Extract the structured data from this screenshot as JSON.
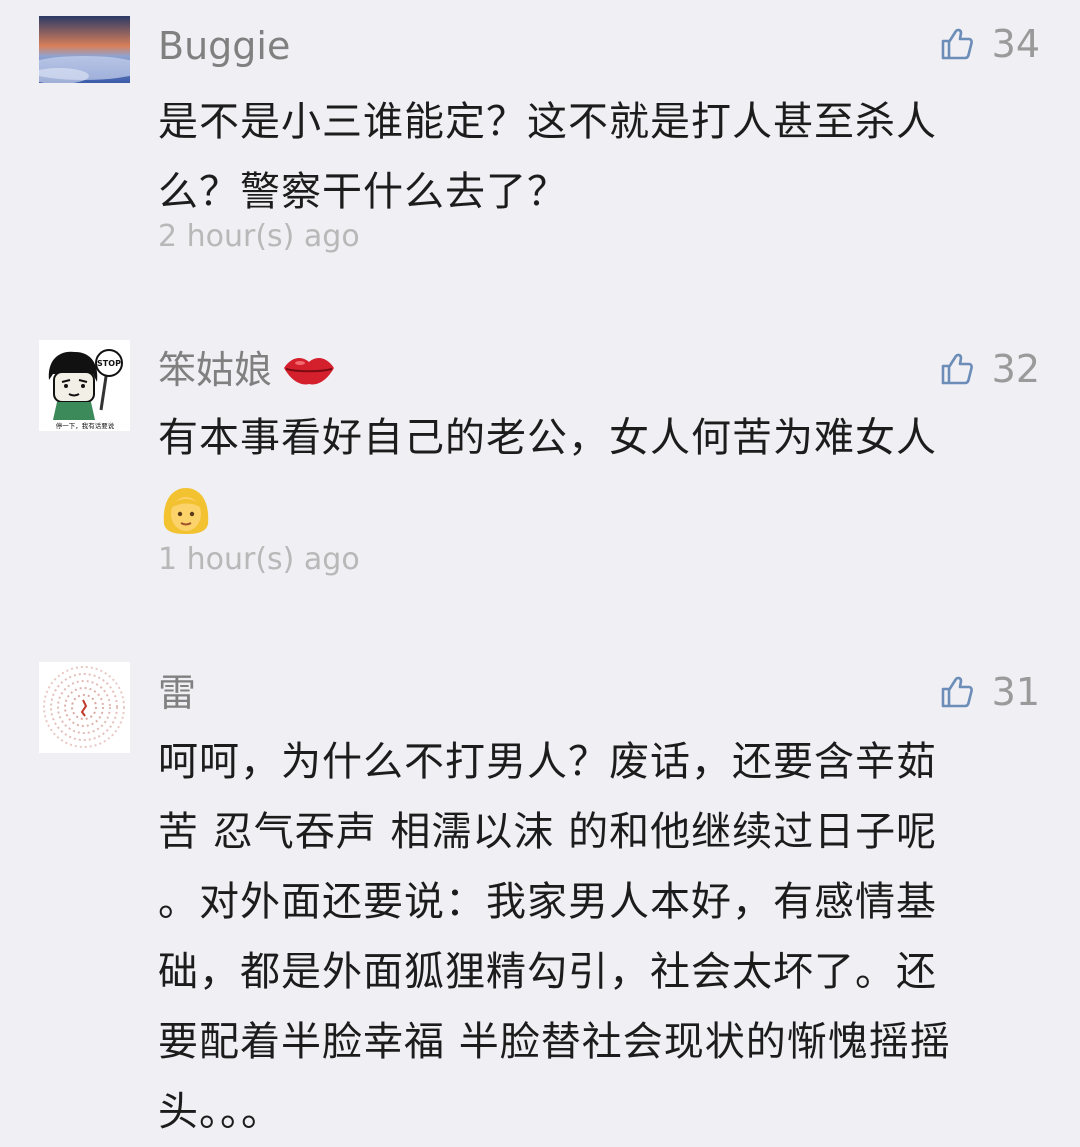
{
  "comments": [
    {
      "name": "Buggie",
      "likes": "34",
      "lines": [
        "是不是小三谁能定？这不就是打人甚至杀人",
        "么？警察干什么去了？"
      ],
      "time": "2 hour(s) ago"
    },
    {
      "name": "笨姑娘",
      "name_icon": "lips-emoji-icon",
      "likes": "32",
      "lines": [
        "有本事看好自己的老公，女人何苦为难女人"
      ],
      "emoji_line_icon": "woman-emoji-icon",
      "time": "1 hour(s) ago",
      "avatar_stop_sign": "STOP",
      "avatar_caption": "停一下，我有话要说"
    },
    {
      "name": "雷",
      "likes": "31",
      "lines": [
        "呵呵，为什么不打男人？废话，还要含辛茹",
        "苦 忍气吞声 相濡以沫 的和他继续过日子呢",
        "。对外面还要说：我家男人本好，有感情基",
        "础，都是外面狐狸精勾引，社会太坏了。还",
        "要配着半脸幸福 半脸替社会现状的惭愧摇摇",
        "头。。。"
      ]
    }
  ]
}
